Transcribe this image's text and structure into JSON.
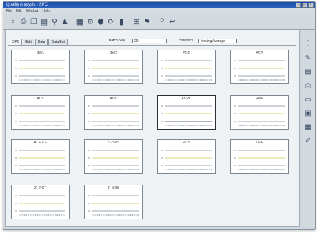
{
  "window": {
    "title": "Quality Analysis - SPC"
  },
  "menu": [
    "File",
    "Edit",
    "Window",
    "Help"
  ],
  "toolbar_icons": [
    "open-file-icon",
    "print-icon",
    "copy-icon",
    "document-icon",
    "search-icon",
    "users-icon",
    "chart-select-icon",
    "settings-icon",
    "stop-icon",
    "refresh-icon",
    "bar-chart-icon",
    "grid-icon",
    "flag-icon",
    "help-icon",
    "exit-icon"
  ],
  "tabs": [
    {
      "label": "SPC",
      "active": true
    },
    {
      "label": "Edit",
      "active": false
    },
    {
      "label": "Data",
      "active": false
    },
    {
      "label": "Data Ent",
      "active": false
    }
  ],
  "batch_size": {
    "label": "Batch Size",
    "value": "20"
  },
  "statistics": {
    "label": "Statistics",
    "value": "Moving Average"
  },
  "charts": [
    {
      "title": "GW1"
    },
    {
      "title": "GW2"
    },
    {
      "title": "POB"
    },
    {
      "title": "ACT"
    },
    {
      "title": "ACS"
    },
    {
      "title": "ACB"
    },
    {
      "title": "ACRC"
    },
    {
      "title": "RMF"
    },
    {
      "title": "ACF CS"
    },
    {
      "title": "Z - SRS"
    },
    {
      "title": "POS"
    },
    {
      "title": "DPF"
    },
    {
      "title": "Z - PCT"
    },
    {
      "title": "Z - SRB"
    }
  ],
  "sidebar_icons": [
    "document-icon",
    "edit-icon",
    "table-icon",
    "printer-icon",
    "page-icon",
    "monitor-icon",
    "chart-monitor-icon",
    "pen-icon"
  ],
  "colors": {
    "frame": "#cfd6dd",
    "titlebar": "#1d4fa8",
    "mean_line": "#c9c94a",
    "limit_line": "#7a8696"
  }
}
